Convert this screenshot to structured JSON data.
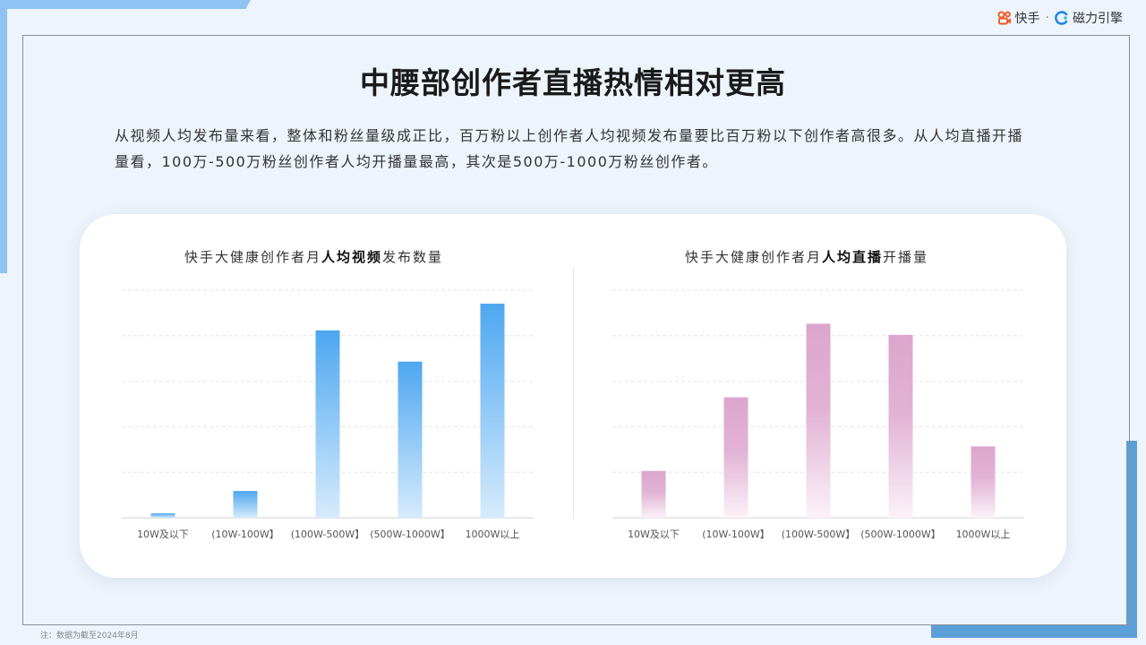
{
  "logo": {
    "kuaishou": "快手",
    "separator": "·",
    "cili": "磁力引擎"
  },
  "title": "中腰部创作者直播热情相对更高",
  "intro": "从视频人均发布量来看，整体和粉丝量级成正比，百万粉以上创作者人均视频发布量要比百万粉以下创作者高很多。从人均直播开播量看，100万-500万粉丝创作者人均开播量最高，其次是500万-1000万粉丝创作者。",
  "footnote": "注：数据为截至2024年8月",
  "colors": {
    "blue": "#4da7f0",
    "blue_light": "#d6ebfc",
    "pink": "#dca6cd",
    "pink_light": "#fbf2f8",
    "grid": "#e5e5e5",
    "axis": "#d0d0d0"
  },
  "chart_data": [
    {
      "type": "bar",
      "title_parts": [
        "快手大健康创作者月",
        "人均视频",
        "发布数量"
      ],
      "categories": [
        "10W及以下",
        "(10W-100W】",
        "(100W-500W】",
        "(500W-1000W】",
        "1000W以上"
      ],
      "values": [
        1,
        6,
        42,
        35,
        48
      ],
      "ylim": [
        0,
        51
      ],
      "grid": true
    },
    {
      "type": "bar",
      "title_parts": [
        "快手大健康创作者月",
        "人均直播",
        "开播量"
      ],
      "categories": [
        "10W及以下",
        "(10W-100W】",
        "(100W-500W】",
        "(500W-1000W】",
        "1000W以上"
      ],
      "values": [
        10.5,
        27,
        43.5,
        41,
        16
      ],
      "ylim": [
        0,
        51
      ],
      "grid": true
    }
  ]
}
